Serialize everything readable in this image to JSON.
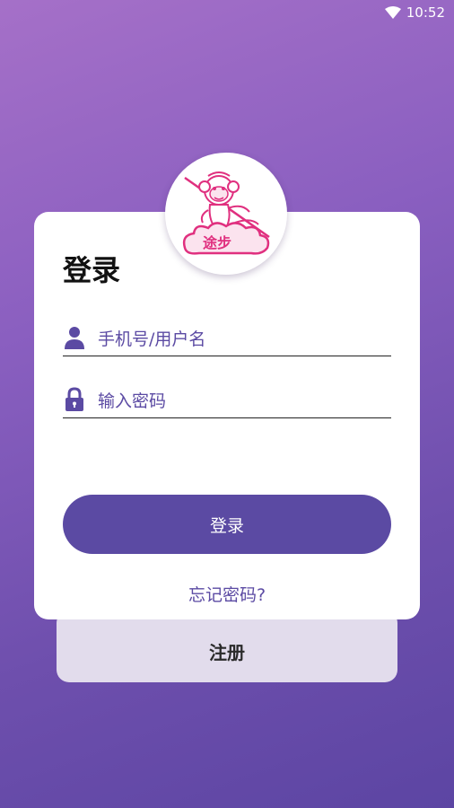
{
  "status_bar": {
    "time": "10:52",
    "wifi_icon": "wifi-icon"
  },
  "logo": {
    "text": "途步",
    "icon": "monkey-logo"
  },
  "login": {
    "title": "登录",
    "username_placeholder": "手机号/用户名",
    "password_placeholder": "输入密码",
    "submit_label": "登录",
    "forgot_label": "忘记密码?"
  },
  "register": {
    "label": "注册"
  },
  "colors": {
    "accent": "#5b4aa3",
    "logo_pink": "#e0307f",
    "card": "#ffffff",
    "register_card": "#e2dcec"
  }
}
